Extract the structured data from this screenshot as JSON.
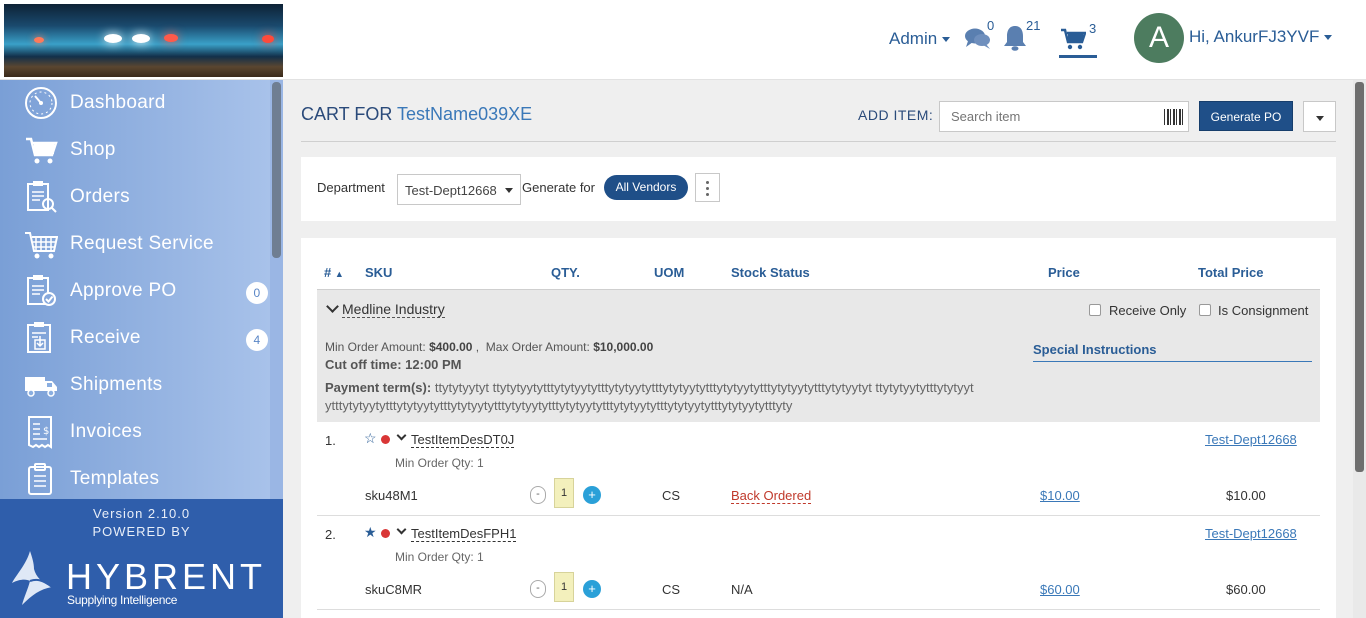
{
  "header": {
    "admin_label": "Admin",
    "messages_count": "0",
    "notifications_count": "21",
    "cart_count": "3",
    "avatar_letter": "A",
    "greeting": "Hi, AnkurFJ3YVF"
  },
  "sidebar": {
    "items": [
      {
        "label": "Dashboard",
        "icon": "dashboard-icon"
      },
      {
        "label": "Shop",
        "icon": "shopping-cart-icon"
      },
      {
        "label": "Orders",
        "icon": "orders-clipboard-icon"
      },
      {
        "label": "Request Service",
        "icon": "request-service-icon"
      },
      {
        "label": "Approve PO",
        "icon": "approve-po-icon",
        "badge": "0"
      },
      {
        "label": "Receive",
        "icon": "receive-icon",
        "badge": "4"
      },
      {
        "label": "Shipments",
        "icon": "truck-icon"
      },
      {
        "label": "Invoices",
        "icon": "invoice-icon"
      },
      {
        "label": "Templates",
        "icon": "templates-icon"
      }
    ],
    "version": "Version 2.10.0",
    "powered_by": "POWERED BY",
    "brand": "HYBRENT",
    "tagline": "Supplying Intelligence"
  },
  "cart": {
    "title_prefix": "CART FOR",
    "title_name": "TestName039XE",
    "add_item_label": "ADD ITEM:",
    "search_placeholder": "Search item",
    "generate_po": "Generate PO",
    "department_label": "Department",
    "department_value": "Test-Dept12668",
    "generate_for_label": "Generate for",
    "generate_for_value": "All Vendors"
  },
  "table": {
    "headers": {
      "num": "#",
      "sku": "SKU",
      "qty": "QTY.",
      "uom": "UOM",
      "stock": "Stock Status",
      "price": "Price",
      "total": "Total Price"
    },
    "vendor": {
      "name": "Medline Industry",
      "receive_only": "Receive Only",
      "is_consignment": "Is Consignment",
      "min_order_label": "Min Order Amount:",
      "min_order_value": "$400.00",
      "max_order_label": "Max Order Amount:",
      "max_order_value": "$10,000.00",
      "cutoff": "Cut off time: 12:00 PM",
      "payment_label": "Payment term(s):",
      "payment_terms": "ttytytyytyt ttytytyytytttytytyytytttytytyytytttytytyytytttytytyytytttytytyytytttytytyytyt ttytytyytytttytytyytytttytytyytytttytytyytytttytytyytytttytytyytytttytytyytytttytytyytytttytytyytytttytytyytytttyty",
      "special_instructions": "Special Instructions"
    },
    "rows": [
      {
        "num": "1.",
        "name": "TestItemDesDT0J",
        "min_qty": "Min Order Qty: 1",
        "dept": "Test-Dept12668",
        "sku": "sku48M1",
        "qty": "1",
        "uom": "CS",
        "stock": "Back Ordered",
        "price": "$10.00",
        "total": "$10.00",
        "favorite": false
      },
      {
        "num": "2.",
        "name": "TestItemDesFPH1",
        "min_qty": "Min Order Qty: 1",
        "dept": "Test-Dept12668",
        "sku": "skuC8MR",
        "qty": "1",
        "uom": "CS",
        "stock": "N/A",
        "price": "$60.00",
        "total": "$60.00",
        "favorite": true
      }
    ]
  },
  "colors": {
    "primary": "#1f4f88",
    "link": "#3a78b8",
    "sidebar_footer": "#2f5eab",
    "danger": "#d93636"
  }
}
